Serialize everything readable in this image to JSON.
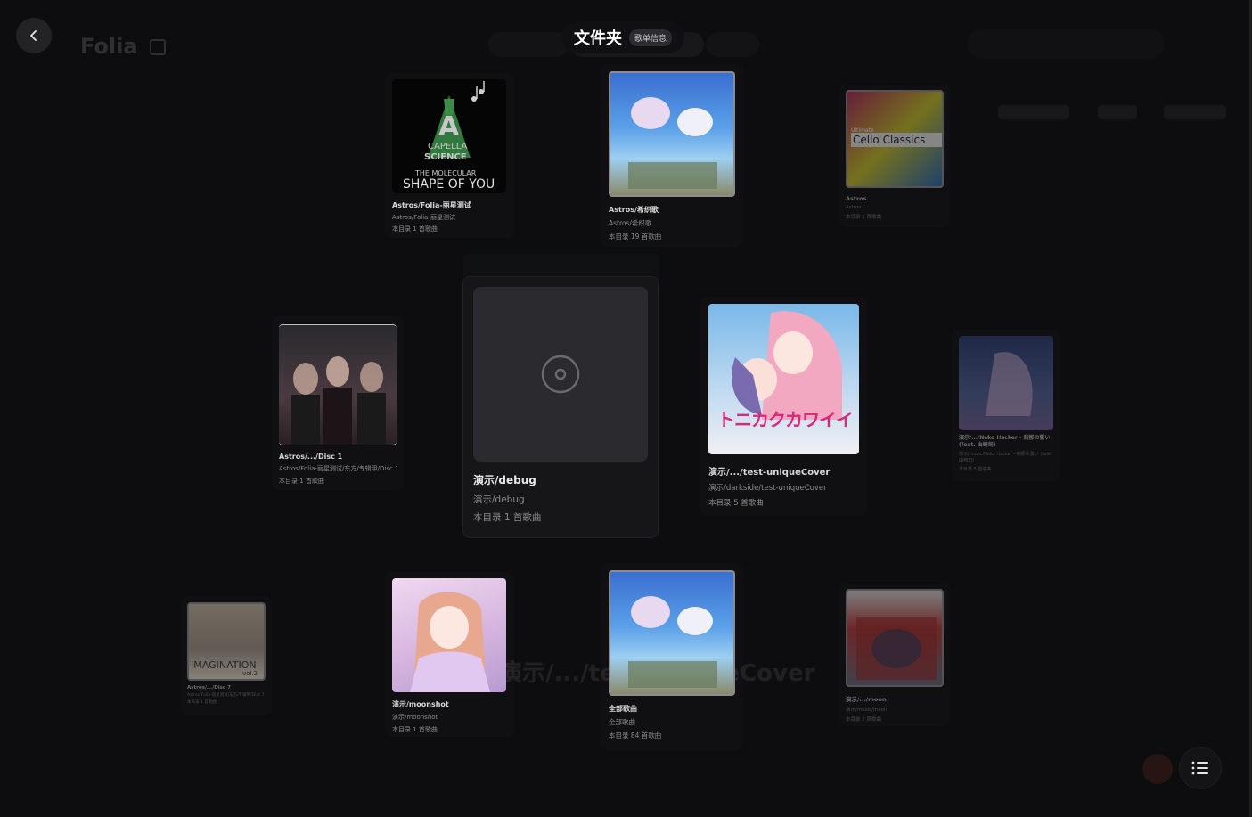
{
  "background_app": {
    "logo": "Folia"
  },
  "header": {
    "title": "文件夹",
    "info_badge": "歌单信息"
  },
  "cards": [
    {
      "key": "c1",
      "title": "Astros/Folia-丽星测试",
      "subtitle": "Astros/Folia-丽星测试",
      "count": "本目录 1 首歌曲",
      "cover_text": [
        "A",
        "CAPELLA",
        "SCIENCE",
        "THE MOLECULAR",
        "SHAPE OF YOU"
      ]
    },
    {
      "key": "c2",
      "title": "Astros/希织歌",
      "subtitle": "Astros/希织歌",
      "count": "本目录 19 首歌曲"
    },
    {
      "key": "c3",
      "title": "Astros",
      "subtitle": "Astros",
      "count": "本目录 1 首歌曲",
      "cover_text": [
        "Ultimate",
        "Cello Classics"
      ]
    },
    {
      "key": "c4",
      "title": "Astros/.../Disc 1",
      "subtitle": "Astros/Folia-丽星测试/东方/专辑甲/Disc 1",
      "count": "本目录 1 首歌曲"
    },
    {
      "key": "c5",
      "title": "演示/debug",
      "subtitle": "演示/debug",
      "count": "本目录 1 首歌曲"
    },
    {
      "key": "c6",
      "title": "演示/.../test-uniqueCover",
      "subtitle": "演示/darkside/test-uniqueCover",
      "count": "本目录 5 首歌曲",
      "cover_text": [
        "トニカクカワイイ"
      ]
    },
    {
      "key": "c7",
      "title": "演示/.../Neko Hacker - 刹那の誓い (feat. 由崎司)",
      "subtitle": "演示/music/Neko Hacker - 刹那の誓い (feat. 由崎司)",
      "count": "本目录 5 首歌曲"
    },
    {
      "key": "c8",
      "title": "Astros/.../Disc 7",
      "subtitle": "Astros/Folia-丽星测试/东方/专辑甲/Disc 7",
      "count": "本目录 1 首歌曲",
      "cover_text": [
        "IMAGINATION",
        "vol.2"
      ]
    },
    {
      "key": "c9",
      "title": "演示/moonshot",
      "subtitle": "演示/moonshot",
      "count": "本目录 1 首歌曲"
    },
    {
      "key": "c10",
      "title": "全部歌曲",
      "subtitle": "全部歌曲",
      "count": "本目录 84 首歌曲"
    },
    {
      "key": "c11",
      "title": "演示/.../moon",
      "subtitle": "演示/music/moon",
      "count": "本目录 2 首歌曲"
    }
  ],
  "ghost_text": "演示/.../test-uniqueCover",
  "colors": {
    "background": "#0d0d0f",
    "accent": "#c0462a",
    "card_placeholder": "#2b2b2f"
  },
  "icons": {
    "back": "chevron-left-icon",
    "list": "list-icon",
    "disc": "disc-icon"
  }
}
